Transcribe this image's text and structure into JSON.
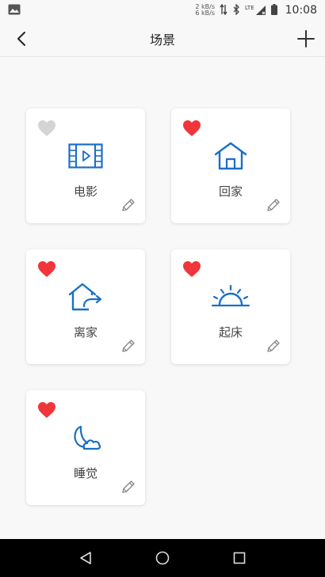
{
  "status_bar": {
    "net_up": "2 kB/s",
    "net_down": "6 kB/s",
    "network": "LTE",
    "time": "10:08"
  },
  "header": {
    "title": "场景"
  },
  "scenes": [
    {
      "label": "电影",
      "favorite": false,
      "icon": "film-icon"
    },
    {
      "label": "回家",
      "favorite": true,
      "icon": "home-icon"
    },
    {
      "label": "离家",
      "favorite": true,
      "icon": "leave-home-icon"
    },
    {
      "label": "起床",
      "favorite": true,
      "icon": "sunrise-icon"
    },
    {
      "label": "睡觉",
      "favorite": true,
      "icon": "moon-cloud-icon"
    }
  ],
  "colors": {
    "accent_blue": "#1a6fc7",
    "heart_red": "#f0353b",
    "heart_gray": "#d4d4d4",
    "edit_gray": "#888888"
  }
}
